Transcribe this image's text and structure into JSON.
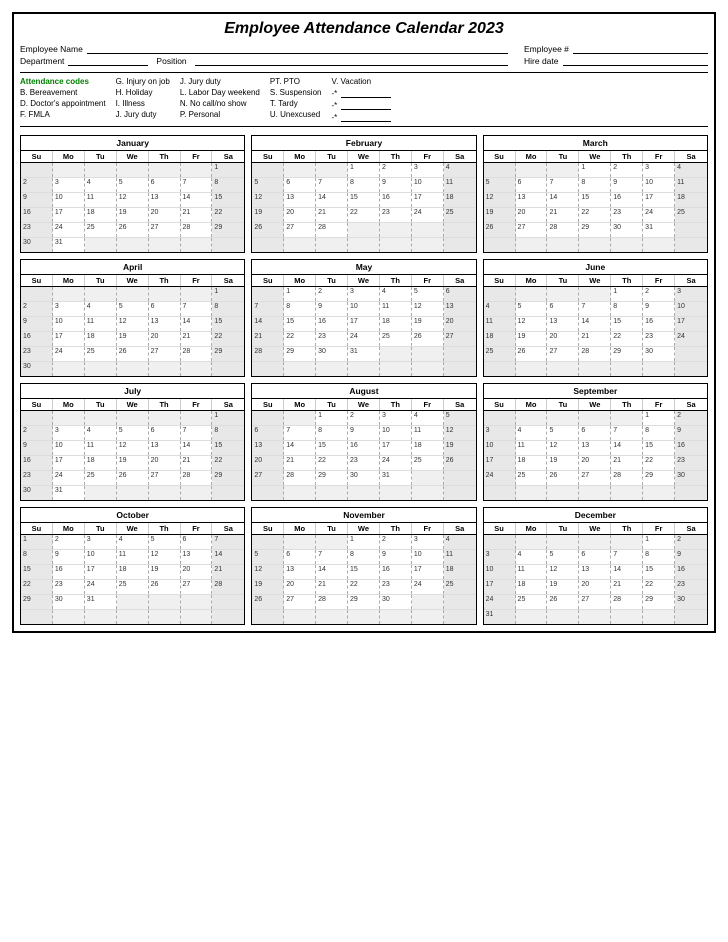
{
  "title": "Employee Attendance Calendar 2023",
  "header": {
    "employee_name_label": "Employee Name",
    "department_label": "Department",
    "position_label": "Position",
    "employee_num_label": "Employee #",
    "hire_date_label": "Hire date"
  },
  "codes": {
    "title": "Attendance codes",
    "items_col1": [
      "B. Bereavement",
      "D. Doctor's appointment",
      "F. FMLA"
    ],
    "items_col2": [
      "G. Injury on job",
      "H. Holiday",
      "I. Illness",
      "J. Jury duty"
    ],
    "items_col3": [
      "J. Jury duty",
      "L. Labor Day weekend",
      "N. No call/no show",
      "P. Personal"
    ],
    "items_col4": [
      "PT. PTO",
      "S. Suspension",
      "T. Tardy",
      "U. Unexcused"
    ],
    "items_col5_label": "V. Vacation"
  },
  "day_headers": [
    "Su",
    "Mo",
    "Tu",
    "We",
    "Th",
    "Fr",
    "Sa"
  ],
  "months": [
    {
      "name": "January",
      "weeks": [
        [
          null,
          null,
          null,
          null,
          null,
          null,
          1
        ],
        [
          2,
          3,
          4,
          5,
          6,
          7,
          8
        ],
        [
          9,
          10,
          11,
          12,
          13,
          14,
          15
        ],
        [
          16,
          17,
          18,
          19,
          20,
          21,
          22
        ],
        [
          23,
          24,
          25,
          26,
          27,
          28,
          29
        ],
        [
          30,
          31,
          null,
          null,
          null,
          null,
          null
        ]
      ]
    },
    {
      "name": "February",
      "weeks": [
        [
          null,
          null,
          null,
          1,
          2,
          3,
          4
        ],
        [
          5,
          6,
          7,
          8,
          9,
          10,
          11
        ],
        [
          12,
          13,
          14,
          15,
          16,
          17,
          18
        ],
        [
          19,
          20,
          21,
          22,
          23,
          24,
          25
        ],
        [
          26,
          27,
          28,
          null,
          null,
          null,
          null
        ],
        [
          null,
          null,
          null,
          null,
          null,
          null,
          null
        ]
      ]
    },
    {
      "name": "March",
      "weeks": [
        [
          null,
          null,
          null,
          1,
          2,
          3,
          4
        ],
        [
          5,
          6,
          7,
          8,
          9,
          10,
          11
        ],
        [
          12,
          13,
          14,
          15,
          16,
          17,
          18
        ],
        [
          19,
          20,
          21,
          22,
          23,
          24,
          25
        ],
        [
          26,
          27,
          28,
          29,
          30,
          31,
          null
        ],
        [
          null,
          null,
          null,
          null,
          null,
          null,
          null
        ]
      ]
    },
    {
      "name": "April",
      "weeks": [
        [
          null,
          null,
          null,
          null,
          null,
          null,
          1
        ],
        [
          2,
          3,
          4,
          5,
          6,
          7,
          8
        ],
        [
          9,
          10,
          11,
          12,
          13,
          14,
          15
        ],
        [
          16,
          17,
          18,
          19,
          20,
          21,
          22
        ],
        [
          23,
          24,
          25,
          26,
          27,
          28,
          29
        ],
        [
          30,
          null,
          null,
          null,
          null,
          null,
          null
        ]
      ]
    },
    {
      "name": "May",
      "weeks": [
        [
          null,
          1,
          2,
          3,
          4,
          5,
          6
        ],
        [
          7,
          8,
          9,
          10,
          11,
          12,
          13
        ],
        [
          14,
          15,
          16,
          17,
          18,
          19,
          20
        ],
        [
          21,
          22,
          23,
          24,
          25,
          26,
          27
        ],
        [
          28,
          29,
          30,
          31,
          null,
          null,
          null
        ],
        [
          null,
          null,
          null,
          null,
          null,
          null,
          null
        ]
      ]
    },
    {
      "name": "June",
      "weeks": [
        [
          null,
          null,
          null,
          null,
          1,
          2,
          3
        ],
        [
          4,
          5,
          6,
          7,
          8,
          9,
          10
        ],
        [
          11,
          12,
          13,
          14,
          15,
          16,
          17
        ],
        [
          18,
          19,
          20,
          21,
          22,
          23,
          24
        ],
        [
          25,
          26,
          27,
          28,
          29,
          30,
          null
        ],
        [
          null,
          null,
          null,
          null,
          null,
          null,
          null
        ]
      ]
    },
    {
      "name": "July",
      "weeks": [
        [
          null,
          null,
          null,
          null,
          null,
          null,
          1
        ],
        [
          2,
          3,
          4,
          5,
          6,
          7,
          8
        ],
        [
          9,
          10,
          11,
          12,
          13,
          14,
          15
        ],
        [
          16,
          17,
          18,
          19,
          20,
          21,
          22
        ],
        [
          23,
          24,
          25,
          26,
          27,
          28,
          29
        ],
        [
          30,
          31,
          null,
          null,
          null,
          null,
          null
        ]
      ]
    },
    {
      "name": "August",
      "weeks": [
        [
          null,
          null,
          1,
          2,
          3,
          4,
          5
        ],
        [
          6,
          7,
          8,
          9,
          10,
          11,
          12
        ],
        [
          13,
          14,
          15,
          16,
          17,
          18,
          19
        ],
        [
          20,
          21,
          22,
          23,
          24,
          25,
          26
        ],
        [
          27,
          28,
          29,
          30,
          31,
          null,
          null
        ],
        [
          null,
          null,
          null,
          null,
          null,
          null,
          null
        ]
      ]
    },
    {
      "name": "September",
      "weeks": [
        [
          null,
          null,
          null,
          null,
          null,
          1,
          2
        ],
        [
          3,
          4,
          5,
          6,
          7,
          8,
          9
        ],
        [
          10,
          11,
          12,
          13,
          14,
          15,
          16
        ],
        [
          17,
          18,
          19,
          20,
          21,
          22,
          23
        ],
        [
          24,
          25,
          26,
          27,
          28,
          29,
          30
        ],
        [
          null,
          null,
          null,
          null,
          null,
          null,
          null
        ]
      ]
    },
    {
      "name": "October",
      "weeks": [
        [
          1,
          2,
          3,
          4,
          5,
          6,
          7
        ],
        [
          8,
          9,
          10,
          11,
          12,
          13,
          14
        ],
        [
          15,
          16,
          17,
          18,
          19,
          20,
          21
        ],
        [
          22,
          23,
          24,
          25,
          26,
          27,
          28
        ],
        [
          29,
          30,
          31,
          null,
          null,
          null,
          null
        ],
        [
          null,
          null,
          null,
          null,
          null,
          null,
          null
        ]
      ]
    },
    {
      "name": "November",
      "weeks": [
        [
          null,
          null,
          null,
          1,
          2,
          3,
          4
        ],
        [
          5,
          6,
          7,
          8,
          9,
          10,
          11
        ],
        [
          12,
          13,
          14,
          15,
          16,
          17,
          18
        ],
        [
          19,
          20,
          21,
          22,
          23,
          24,
          25
        ],
        [
          26,
          27,
          28,
          29,
          30,
          null,
          null
        ],
        [
          null,
          null,
          null,
          null,
          null,
          null,
          null
        ]
      ]
    },
    {
      "name": "December",
      "weeks": [
        [
          null,
          null,
          null,
          null,
          null,
          1,
          2
        ],
        [
          3,
          4,
          5,
          6,
          7,
          8,
          9
        ],
        [
          10,
          11,
          12,
          13,
          14,
          15,
          16
        ],
        [
          17,
          18,
          19,
          20,
          21,
          22,
          23
        ],
        [
          24,
          25,
          26,
          27,
          28,
          29,
          30
        ],
        [
          31,
          null,
          null,
          null,
          null,
          null,
          null
        ]
      ]
    }
  ]
}
